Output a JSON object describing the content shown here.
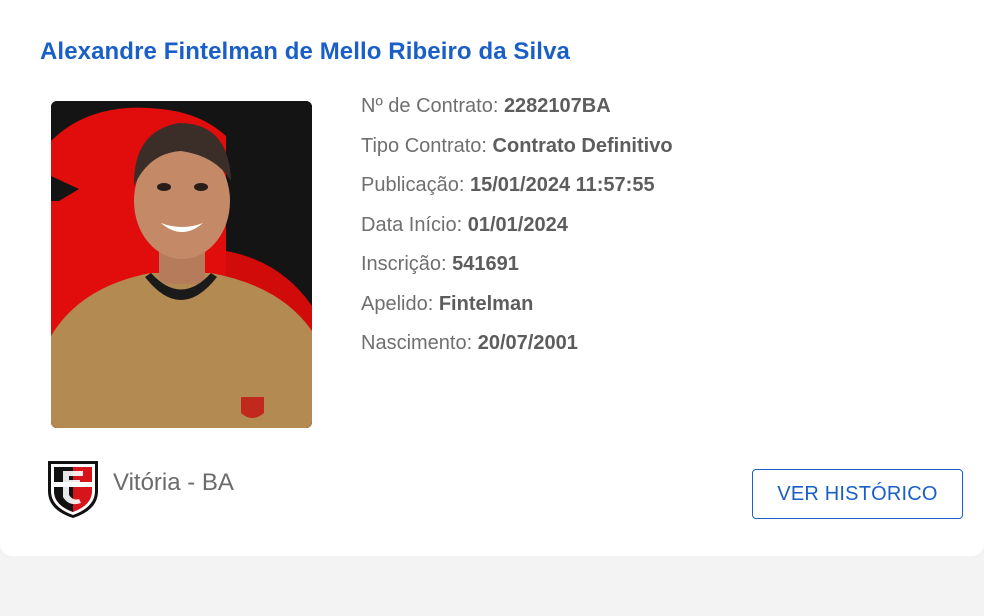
{
  "player": {
    "name": "Alexandre Fintelman de Mello Ribeiro da Silva",
    "photo_icon": "player-photo",
    "details": [
      {
        "label": "Nº de Contrato: ",
        "value": "2282107BA"
      },
      {
        "label": "Tipo Contrato: ",
        "value": "Contrato Definitivo"
      },
      {
        "label": "Publicação: ",
        "value": "15/01/2024 11:57:55"
      },
      {
        "label": "Data Início: ",
        "value": "01/01/2024"
      },
      {
        "label": "Inscrição: ",
        "value": "541691"
      },
      {
        "label": "Apelido: ",
        "value": "Fintelman"
      },
      {
        "label": "Nascimento: ",
        "value": "20/07/2001"
      }
    ]
  },
  "club": {
    "name": "Vitória - BA",
    "badge_icon": "club-crest-icon",
    "colors": {
      "primary": "#d7141a",
      "secondary": "#111111"
    }
  },
  "actions": {
    "history_label": "VER HISTÓRICO"
  },
  "theme": {
    "accent": "#1a5fc8"
  }
}
